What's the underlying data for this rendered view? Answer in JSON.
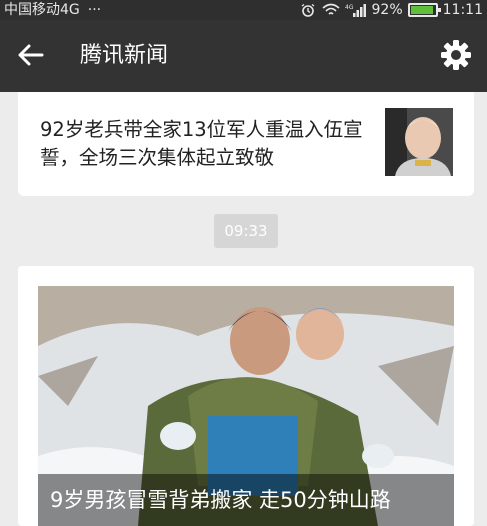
{
  "status_bar": {
    "carrier": "中国移动4G",
    "more": "···",
    "network": "4G",
    "battery_percent": "92%",
    "time": "11:11",
    "icons": [
      "alarm-icon",
      "wifi-icon",
      "signal-icon",
      "battery-icon"
    ]
  },
  "header": {
    "title": "腾讯新闻",
    "back_icon": "arrow-left-icon",
    "settings_icon": "gear-icon"
  },
  "news_item": {
    "title": "92岁老兵带全家13位军人重温入伍宣誓，全场三次集体起立致敬"
  },
  "timestamp": "09:33",
  "feature_item": {
    "caption": "9岁男孩冒雪背弟搬家 走50分钟山路"
  },
  "colors": {
    "app_bar": "#333333",
    "status_bar": "#2f2f2f",
    "background": "#ececec",
    "card": "#ffffff",
    "time_badge": "#d6d6d6"
  }
}
